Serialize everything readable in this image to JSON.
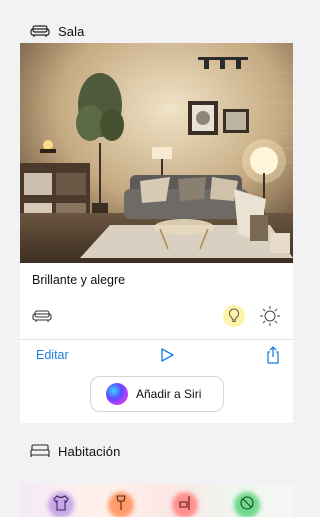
{
  "section_sala": {
    "title": "Sala",
    "icon": "sofa-icon"
  },
  "scene": {
    "name": "Brillante y alegre",
    "room_icon": "sofa-icon",
    "status_icons": [
      "lightbulb-icon",
      "sun-icon"
    ],
    "edit_label": "Editar",
    "play_icon": "play-icon",
    "share_icon": "share-icon",
    "siri_label": "Añadir a Siri"
  },
  "section_habitacion": {
    "title": "Habitación",
    "icon": "bed-icon",
    "scene_icons": [
      "shirt-icon",
      "floor-lamp-icon",
      "desk-lamp-icon",
      "off-icon"
    ]
  },
  "colors": {
    "accent": "#1f7fe0",
    "bulb_glow": "#fff3a8",
    "blob_1": "#c8a7e8",
    "blob_2": "#ff9b6a",
    "blob_3": "#ff8f8f",
    "blob_4": "#6fd98c"
  }
}
